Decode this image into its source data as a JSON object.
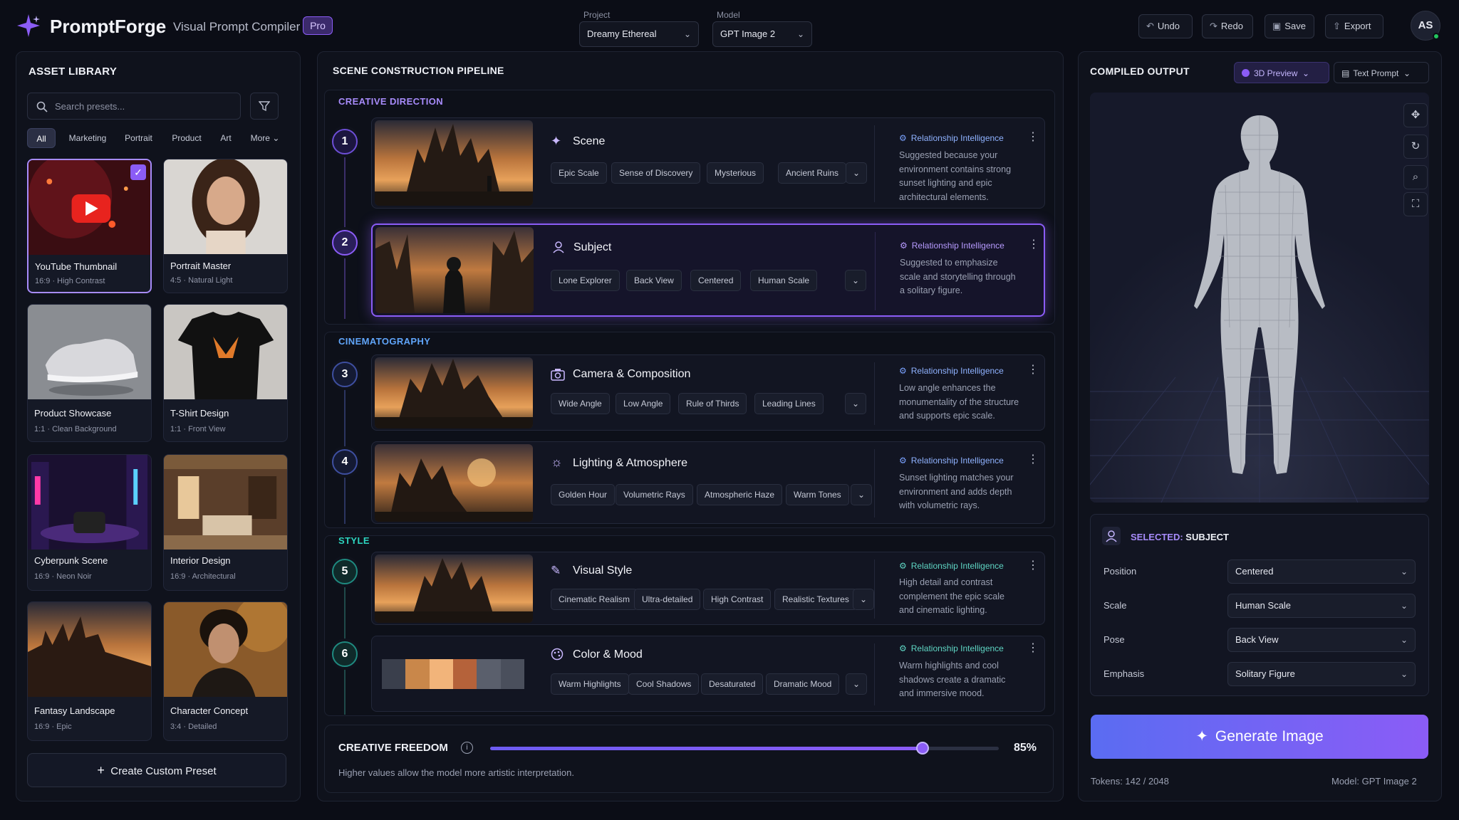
{
  "header": {
    "brand": "PromptForge",
    "subtitle": "Visual Prompt Compiler",
    "badge": "Pro",
    "project_label": "Project",
    "project_value": "Dreamy Ethereal",
    "model_label": "Model",
    "model_value": "GPT Image 2",
    "undo": "Undo",
    "redo": "Redo",
    "save": "Save",
    "export": "Export",
    "avatar": "AS"
  },
  "library": {
    "title": "ASSET LIBRARY",
    "search_placeholder": "Search presets...",
    "filters": [
      "All",
      "Marketing",
      "Portrait",
      "Product",
      "Art",
      "More"
    ],
    "cards": [
      {
        "name": "YouTube Thumbnail",
        "meta": "16:9 · High Contrast"
      },
      {
        "name": "Portrait Master",
        "meta": "4:5 · Natural Light"
      },
      {
        "name": "Product Showcase",
        "meta": "1:1 · Clean Background"
      },
      {
        "name": "T-Shirt Design",
        "meta": "1:1 · Front View"
      },
      {
        "name": "Cyberpunk Scene",
        "meta": "16:9 · Neon Noir"
      },
      {
        "name": "Interior Design",
        "meta": "16:9 · Architectural"
      },
      {
        "name": "Fantasy Landscape",
        "meta": "16:9 · Epic"
      },
      {
        "name": "Character Concept",
        "meta": "3:4 · Detailed"
      }
    ],
    "create": "Create Custom Preset"
  },
  "pipeline": {
    "title": "SCENE CONSTRUCTION PIPELINE",
    "sections": [
      "CREATIVE DIRECTION",
      "CINEMATOGRAPHY",
      "STYLE"
    ],
    "ri_label": "Relationship Intelligence",
    "steps": [
      {
        "num": "1",
        "title": "Scene",
        "tags": [
          "Epic Scale",
          "Sense of Discovery",
          "Mysterious",
          "Ancient Ruins"
        ],
        "desc": "Suggested because your environment contains strong sunset lighting and epic architectural elements."
      },
      {
        "num": "2",
        "title": "Subject",
        "tags": [
          "Lone Explorer",
          "Back View",
          "Centered",
          "Human Scale"
        ],
        "desc": "Suggested to emphasize scale and storytelling through a solitary figure."
      },
      {
        "num": "3",
        "title": "Camera & Composition",
        "tags": [
          "Wide Angle",
          "Low Angle",
          "Rule of Thirds",
          "Leading Lines"
        ],
        "desc": "Low angle enhances the monumentality of the structure and supports epic scale."
      },
      {
        "num": "4",
        "title": "Lighting & Atmosphere",
        "tags": [
          "Golden Hour",
          "Volumetric Rays",
          "Atmospheric Haze",
          "Warm Tones"
        ],
        "desc": "Sunset lighting matches your environment and adds depth with volumetric rays."
      },
      {
        "num": "5",
        "title": "Visual Style",
        "tags": [
          "Cinematic Realism",
          "Ultra-detailed",
          "High Contrast",
          "Realistic Textures"
        ],
        "desc": "High detail and contrast complement the epic scale and cinematic lighting."
      },
      {
        "num": "6",
        "title": "Color & Mood",
        "tags": [
          "Warm Highlights",
          "Cool Shadows",
          "Desaturated",
          "Dramatic Mood"
        ],
        "desc": "Warm highlights and cool shadows create a dramatic and immersive mood."
      }
    ],
    "palette": [
      "#3a3f4c",
      "#c9874a",
      "#f2b47a",
      "#b5623a",
      "#5a5f6c",
      "#4a4f5c"
    ],
    "freedom_title": "CREATIVE FREEDOM",
    "freedom_value": 85,
    "freedom_text": "85%",
    "freedom_desc": "Higher values allow the model more artistic interpretation."
  },
  "output": {
    "title": "COMPILED OUTPUT",
    "tab_3d": "3D Preview",
    "tab_text": "Text Prompt",
    "selected_prefix": "SELECTED:",
    "selected_value": "SUBJECT",
    "props": [
      {
        "label": "Position",
        "value": "Centered"
      },
      {
        "label": "Scale",
        "value": "Human Scale"
      },
      {
        "label": "Pose",
        "value": "Back View"
      },
      {
        "label": "Emphasis",
        "value": "Solitary Figure"
      }
    ],
    "generate": "Generate Image",
    "tokens": "Tokens: 142 / 2048",
    "model_footer": "Model: GPT Image 2"
  },
  "colors": {
    "accent": "#8b5cf6",
    "accent_blue": "#5a6cf2",
    "bg": "#0b0d16",
    "section_purple": "#a78bfa",
    "section_blue": "#60a5fa",
    "section_teal": "#2dd4bf"
  }
}
